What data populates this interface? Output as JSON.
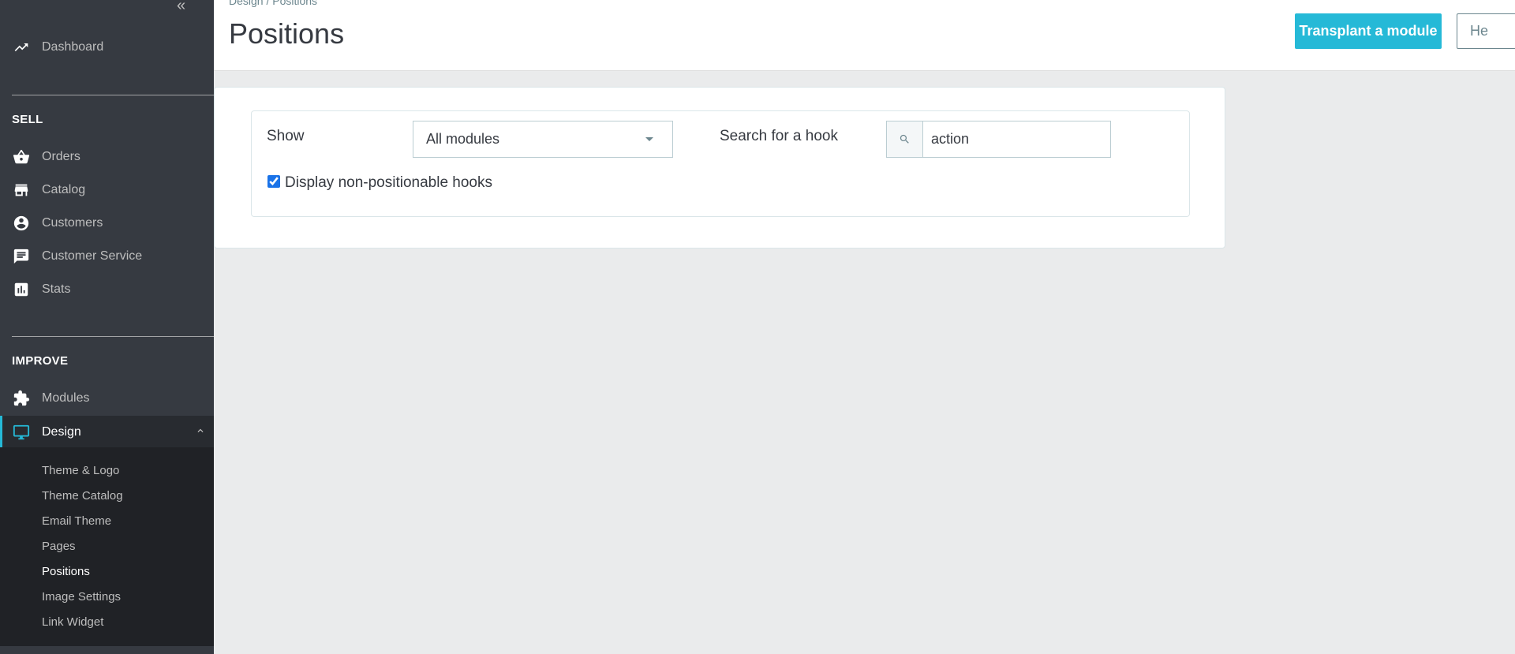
{
  "sidebar": {
    "collapse_glyph": "«",
    "dashboard": "Dashboard",
    "sell_title": "SELL",
    "sell_items": [
      "Orders",
      "Catalog",
      "Customers",
      "Customer Service",
      "Stats"
    ],
    "improve_title": "IMPROVE",
    "improve_items": [
      "Modules",
      "Design"
    ],
    "design_submenu": [
      "Theme & Logo",
      "Theme Catalog",
      "Email Theme",
      "Pages",
      "Positions",
      "Image Settings",
      "Link Widget"
    ],
    "active_subitem": "Positions"
  },
  "header": {
    "breadcrumb": "Design  /  Positions",
    "title": "Positions",
    "transplant_button": "Transplant a module",
    "help_button": "He"
  },
  "filters": {
    "show_label": "Show",
    "show_value": "All modules",
    "search_label": "Search for a hook",
    "search_value": "action",
    "display_hooks_label": "Display non-positionable hooks",
    "display_hooks_checked": true
  },
  "colors": {
    "sidebar_bg": "#363a41",
    "submenu_bg": "#202226",
    "accent": "#25b9d7",
    "page_bg": "#eaebec"
  }
}
